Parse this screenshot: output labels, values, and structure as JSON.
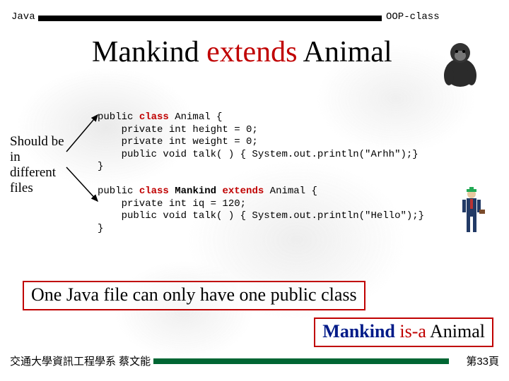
{
  "header": {
    "left": "Java",
    "right": "OOP-class"
  },
  "title": {
    "w1": "Mankind ",
    "w2": "extends",
    "w3": " Animal"
  },
  "note": "Should be in different files",
  "code": {
    "l1a": "public ",
    "l1b": "class",
    "l1c": " Animal {",
    "l2": "    private int height = 0;",
    "l3": "    private int weight = 0;",
    "l4": "    public void talk( ) { System.out.println(\"Arhh\");}",
    "l5": "}",
    "l6": "",
    "l7a": "public ",
    "l7b": "class",
    "l7c": " ",
    "l7d": "Mankind",
    "l7e": " ",
    "l7f": "extends",
    "l7g": " Animal {",
    "l8": "    private int iq = 120;",
    "l9": "    public void talk( ) { System.out.println(\"Hello\");}",
    "l10": "}"
  },
  "one_file": "One Java file can only have one public class",
  "isa": {
    "w1": "Mankind",
    "w2": " is-a",
    "w3": " Animal"
  },
  "footer": {
    "left": "交通大學資訊工程學系 蔡文能",
    "right": "第33頁"
  }
}
